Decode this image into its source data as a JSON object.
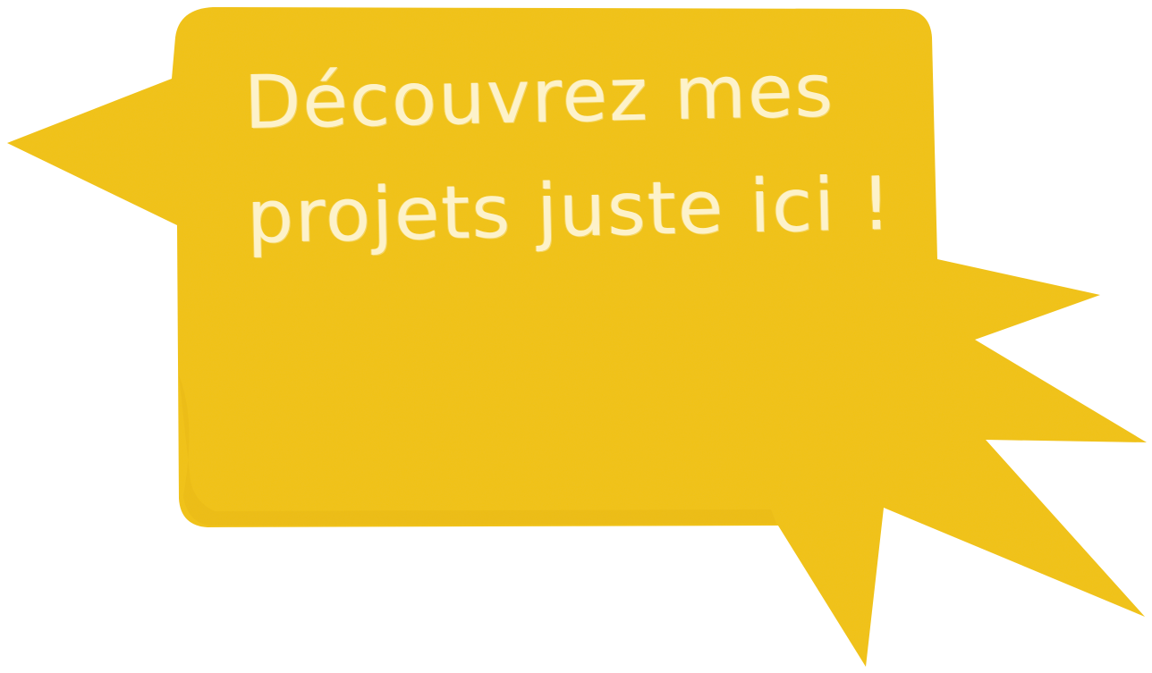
{
  "bubble": {
    "line1": "Découvrez mes",
    "line2": "projets juste ici !",
    "fill_color": "#f2c31f",
    "shadow_color": "#e0ad14",
    "text_color": "#fff6d8"
  }
}
